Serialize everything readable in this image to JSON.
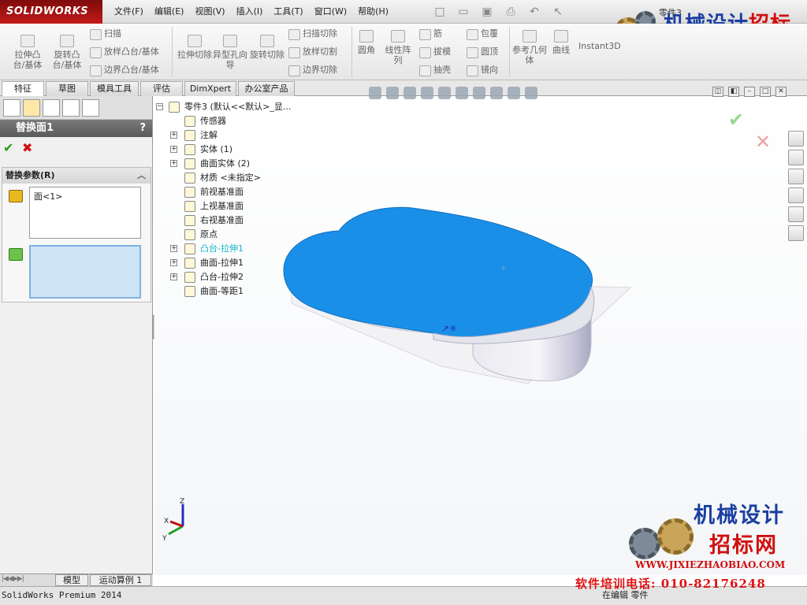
{
  "app": {
    "brand": "SOLIDWORKS",
    "doc_title": "零件3"
  },
  "menu": [
    "文件(F)",
    "编辑(E)",
    "视图(V)",
    "插入(I)",
    "工具(T)",
    "窗口(W)",
    "帮助(H)"
  ],
  "ribbon": {
    "extrude_boss": "拉伸凸台/基体",
    "revolve_boss": "旋转凸台/基体",
    "sweep": "扫描",
    "loft_boss": "放样凸台/基体",
    "boundary_boss": "边界凸台/基体",
    "extrude_cut": "拉伸切除",
    "hole_wizard": "异型孔向导",
    "revolve_cut": "旋转切除",
    "swept_cut": "扫描切除",
    "lofted_cut": "放样切割",
    "boundary_cut": "边界切除",
    "fillet": "圆角",
    "linear_pattern": "线性阵列",
    "rib": "筋",
    "draft": "拔模",
    "shell": "抽壳",
    "wrap": "包覆",
    "dome": "圆顶",
    "mirror": "镜向",
    "ref_geometry": "参考几何体",
    "curves": "曲线",
    "instant3d": "Instant3D"
  },
  "tabs": [
    "特征",
    "草图",
    "模具工具",
    "评估",
    "DimXpert",
    "办公室产品"
  ],
  "property_manager": {
    "title": "替换面1",
    "help": "?",
    "group_title": "替换参数(R)",
    "target_faces": "面<1>"
  },
  "tree": {
    "root": "零件3  (默认<<默认>_显...",
    "items": [
      {
        "label": "传感器",
        "expand": false
      },
      {
        "label": "注解",
        "expand": true
      },
      {
        "label": "实体 (1)",
        "expand": true
      },
      {
        "label": "曲面实体 (2)",
        "expand": true
      },
      {
        "label": "材质 <未指定>",
        "expand": false
      },
      {
        "label": "前视基准面",
        "expand": false
      },
      {
        "label": "上视基准面",
        "expand": false
      },
      {
        "label": "右视基准面",
        "expand": false
      },
      {
        "label": "原点",
        "expand": false
      },
      {
        "label": "凸台-拉伸1",
        "expand": true,
        "highlight": true
      },
      {
        "label": "曲面-拉伸1",
        "expand": true
      },
      {
        "label": "凸台-拉伸2",
        "expand": true
      },
      {
        "label": "曲面-等距1",
        "expand": false
      }
    ]
  },
  "bottom_tabs": [
    "模型",
    "运动算例 1"
  ],
  "status": {
    "left": "SolidWorks Premium 2014",
    "right": "在编辑 零件"
  },
  "watermark": {
    "top_title_a": "机械设计",
    "top_title_b": "招标网",
    "url": "WWW.JIXIEZHAOBIAO.COM",
    "bottom_line1": "机械设计",
    "bottom_line2": "招标网",
    "phone": "软件培训电话: 010-82176248"
  },
  "colors": {
    "accent_blue": "#1a8fe8",
    "brand_red": "#c41a1a",
    "watermark_blue": "#1a3fa0",
    "watermark_red": "#d01010"
  }
}
